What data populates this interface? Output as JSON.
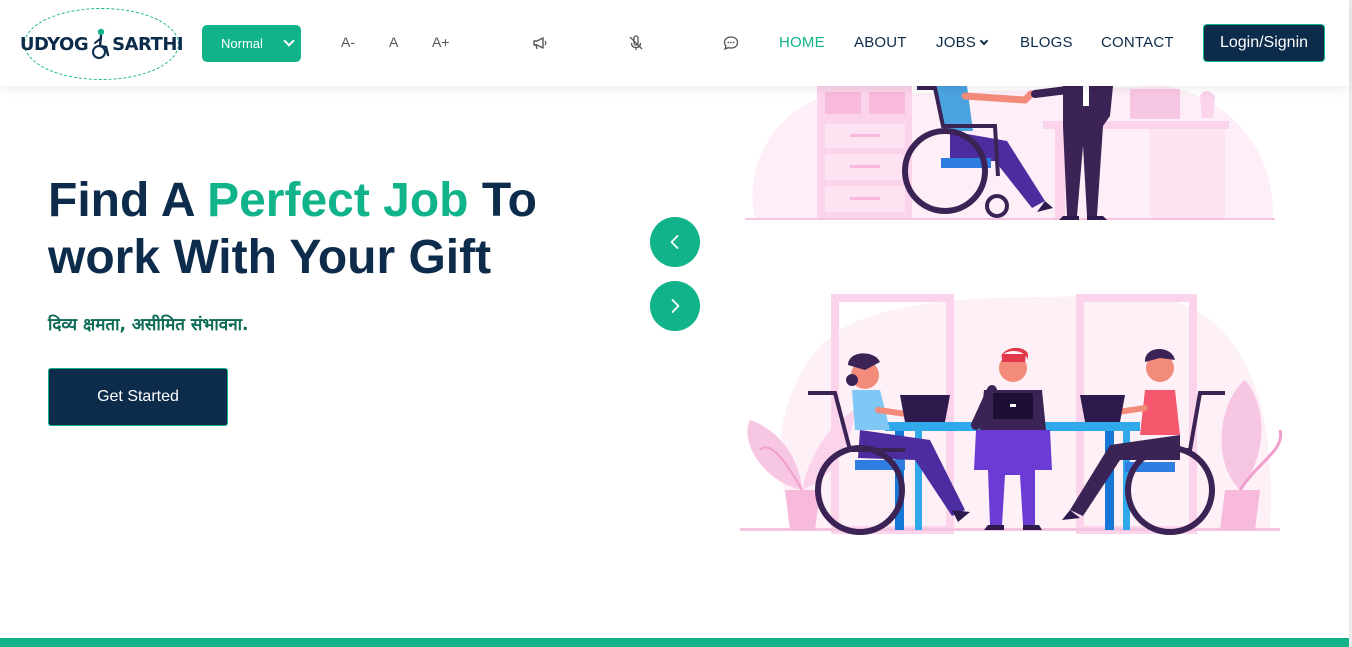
{
  "logo": {
    "part1": "UDYOG",
    "part2": "SARTHI"
  },
  "accessibility": {
    "mode": "Normal",
    "font_decrease": "A-",
    "font_normal": "A",
    "font_increase": "A+",
    "icons": [
      "megaphone-icon",
      "mic-off-icon",
      "chat-icon"
    ]
  },
  "nav": {
    "home": "HOME",
    "about": "ABOUT",
    "jobs": "JOBS",
    "blogs": "BLOGS",
    "contact": "CONTACT",
    "login": "Login/Signin"
  },
  "hero": {
    "title_part1": "Find A ",
    "title_accent": "Perfect Job",
    "title_part2": " To work With Your Gift",
    "subtitle": "दिव्य क्षमता, असीमित संभावना.",
    "cta": "Get Started"
  },
  "colors": {
    "brand_green": "#10b38a",
    "navy": "#0d2b4a",
    "illustration_pink": "#fbd3ea"
  }
}
